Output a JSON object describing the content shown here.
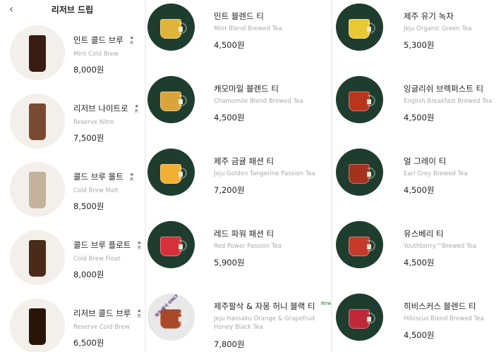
{
  "header": {
    "title": "리저브 드립",
    "back_icon": "chevron-left-icon"
  },
  "column1": [
    {
      "name": "민트 콜드 브루",
      "en": "Mint Cold Brew",
      "price": "8,000원",
      "reserve": true
    },
    {
      "name": "리저브 나이트로",
      "en": "Reserve Nitro",
      "price": "7,500원",
      "reserve": true
    },
    {
      "name": "콜드 브루 몰트",
      "en": "Cold Brew Malt",
      "price": "8,500원",
      "reserve": true
    },
    {
      "name": "콜드 브루 플로트",
      "en": "Cold Brew Float",
      "price": "8,000원",
      "reserve": true
    },
    {
      "name": "리저브 콜드 브루",
      "en": "Reserve Cold Brew",
      "price": "6,500원",
      "reserve": true
    }
  ],
  "column2": [
    {
      "name": "민트 블렌드 티",
      "en": "Mint Blend Brewed Tea",
      "price": "4,500원"
    },
    {
      "name": "캐모마일 블렌드 티",
      "en": "Chamomile Blend Brewed Tea",
      "price": "4,500원"
    },
    {
      "name": "제주 금귤 패션 티",
      "en": "Jeju Golden Tangerine Passion Tea",
      "price": "7,200원"
    },
    {
      "name": "레드 파워 패션 티",
      "en": "Red Power Passion Tea",
      "price": "5,900원"
    },
    {
      "name": "제주팔삭 & 자몽 허니 블랙 티",
      "en": "Jeju Hassaku Orange & Grapefruit Honey Black Tea",
      "price": "7,800원",
      "new": "New",
      "swirl_text": "제주 팔삭 ONLY"
    }
  ],
  "column3": [
    {
      "name": "제주 유기 녹차",
      "en": "Jeju Organic Green Tea",
      "price": "5,300원"
    },
    {
      "name": "잉글리쉬 브렉퍼스트 티",
      "en": "English Breakfast Brewed Tea",
      "price": "4,500원"
    },
    {
      "name": "얼 그레이 티",
      "en": "Earl Grey Brewed Tea",
      "price": "4,500원"
    },
    {
      "name": "유스베리 티",
      "en": "Youthberry™Brewed Tea",
      "price": "4,500원"
    },
    {
      "name": "히비스커스 블렌드 티",
      "en": "Hibiscus Blend Brewed Tea",
      "price": "4,500원"
    }
  ],
  "colors": {
    "thumb_bg_dark": "#1f3d2e",
    "thumb_bg_light": "#f3efea",
    "drinks1": [
      "#3a1d12",
      "#7a4a30",
      "#c4b29a",
      "#4a2a18",
      "#2a1408"
    ],
    "drinks2": [
      "#e0b43a",
      "#d9a53a",
      "#f2b033",
      "#d8303a",
      "#a84a2a"
    ],
    "drinks3": [
      "#e8c935",
      "#b8361e",
      "#a3331c",
      "#c53a2a",
      "#c0283a"
    ]
  }
}
